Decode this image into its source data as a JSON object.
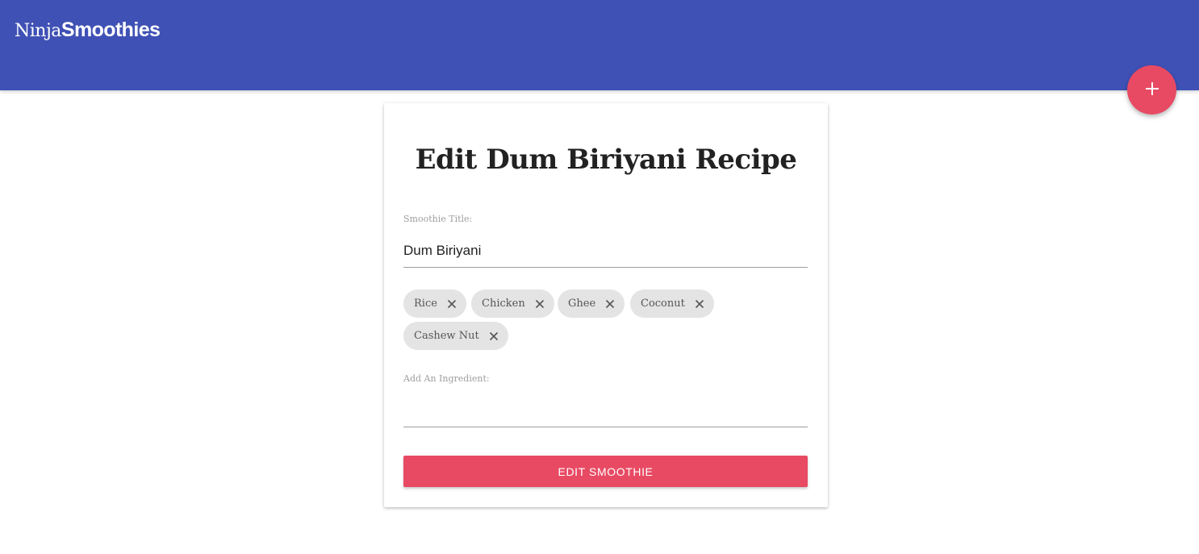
{
  "navbar": {
    "brand_light": "Ninja",
    "brand_bold": "Smoothies",
    "color": "#3f51b5"
  },
  "fab": {
    "icon": "plus-icon",
    "color": "#e84a63"
  },
  "form": {
    "title": "Edit Dum Biriyani Recipe",
    "title_label": "Smoothie Title:",
    "title_value": "Dum Biriyani",
    "ingredients": [
      {
        "label": "Rice",
        "icon": "close-icon"
      },
      {
        "label": "Chicken",
        "icon": "close-icon"
      },
      {
        "label": "Ghee",
        "icon": "close-icon"
      },
      {
        "label": "Coconut",
        "icon": "close-icon"
      },
      {
        "label": "Cashew Nut",
        "icon": "close-icon"
      }
    ],
    "ingredient_label": "Add An Ingredient:",
    "ingredient_value": "",
    "submit_label": "EDIT SMOOTHIE",
    "accent": "#e84a63"
  }
}
